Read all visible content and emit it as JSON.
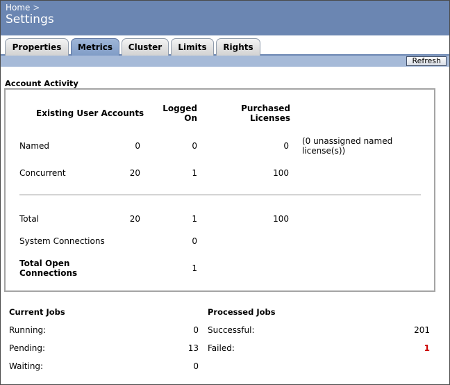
{
  "breadcrumb": {
    "home": "Home",
    "separator": ">"
  },
  "page_title": "Settings",
  "tabs": [
    {
      "label": "Properties",
      "active": false
    },
    {
      "label": "Metrics",
      "active": true
    },
    {
      "label": "Cluster",
      "active": false
    },
    {
      "label": "Limits",
      "active": false
    },
    {
      "label": "Rights",
      "active": false
    }
  ],
  "toolbar": {
    "refresh_label": "Refresh"
  },
  "account_activity": {
    "title": "Account Activity",
    "headers": {
      "existing": "Existing User Accounts",
      "logged_on_1": "Logged",
      "logged_on_2": "On",
      "purchased_1": "Purchased",
      "purchased_2": "Licenses"
    },
    "rows": {
      "named": {
        "label": "Named",
        "existing": "0",
        "logged_on": "0",
        "purchased": "0",
        "note_1": "(0 unassigned named",
        "note_2": "license(s))"
      },
      "concurrent": {
        "label": "Concurrent",
        "existing": "20",
        "logged_on": "1",
        "purchased": "100"
      },
      "total": {
        "label": "Total",
        "existing": "20",
        "logged_on": "1",
        "purchased": "100"
      },
      "system_connections": {
        "label": "System Connections",
        "logged_on": "0"
      },
      "total_open": {
        "label_1": "Total Open",
        "label_2": "Connections",
        "logged_on": "1"
      }
    }
  },
  "current_jobs": {
    "title": "Current Jobs",
    "running": {
      "label": "Running:",
      "value": "0"
    },
    "pending": {
      "label": "Pending:",
      "value": "13"
    },
    "waiting": {
      "label": "Waiting:",
      "value": "0"
    }
  },
  "processed_jobs": {
    "title": "Processed Jobs",
    "successful": {
      "label": "Successful:",
      "value": "201"
    },
    "failed": {
      "label": "Failed:",
      "value": "1"
    }
  },
  "colors": {
    "header": "#6b86b2",
    "active_tab": "#8aa3cc",
    "toolstrip": "#a6bad8",
    "failed_value": "#cc0000"
  }
}
